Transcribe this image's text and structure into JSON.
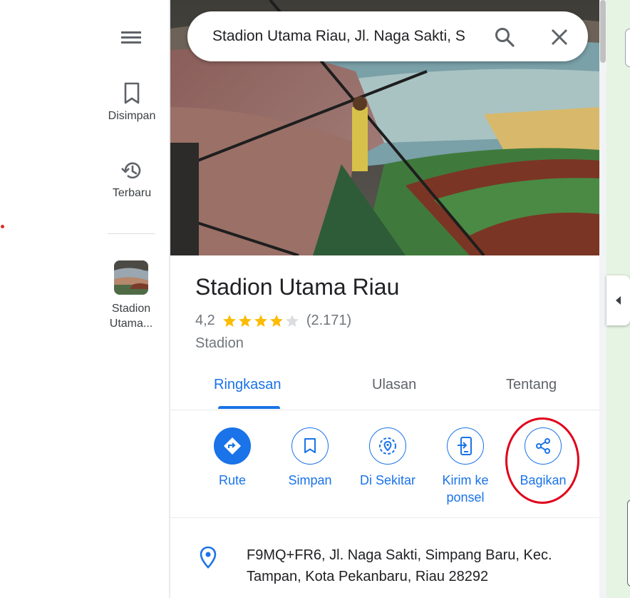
{
  "search": {
    "value": "Stadion Utama Riau, Jl. Naga Sakti, S"
  },
  "rail": {
    "saved_label": "Disimpan",
    "recent_label": "Terbaru",
    "recent_place_label": "Stadion Utama..."
  },
  "place": {
    "title": "Stadion Utama Riau",
    "rating": "4,2",
    "stars_filled": 4,
    "stars_total": 5,
    "review_count": "(2.171)",
    "category": "Stadion"
  },
  "tabs": [
    {
      "label": "Ringkasan",
      "active": true
    },
    {
      "label": "Ulasan",
      "active": false
    },
    {
      "label": "Tentang",
      "active": false
    }
  ],
  "actions": [
    {
      "label": "Rute",
      "icon": "directions-icon"
    },
    {
      "label": "Simpan",
      "icon": "bookmark-icon"
    },
    {
      "label": "Di Sekitar",
      "icon": "nearby-icon"
    },
    {
      "label": "Kirim ke ponsel",
      "icon": "send-to-phone-icon"
    },
    {
      "label": "Bagikan",
      "icon": "share-icon"
    }
  ],
  "address": {
    "text": "F9MQ+FR6, Jl. Naga Sakti, Simpang Baru, Kec. Tampan, Kota Pekanbaru, Riau 28292"
  },
  "colors": {
    "accent": "#1a73e8",
    "star": "#fbbc04",
    "highlight": "#e0001b"
  }
}
